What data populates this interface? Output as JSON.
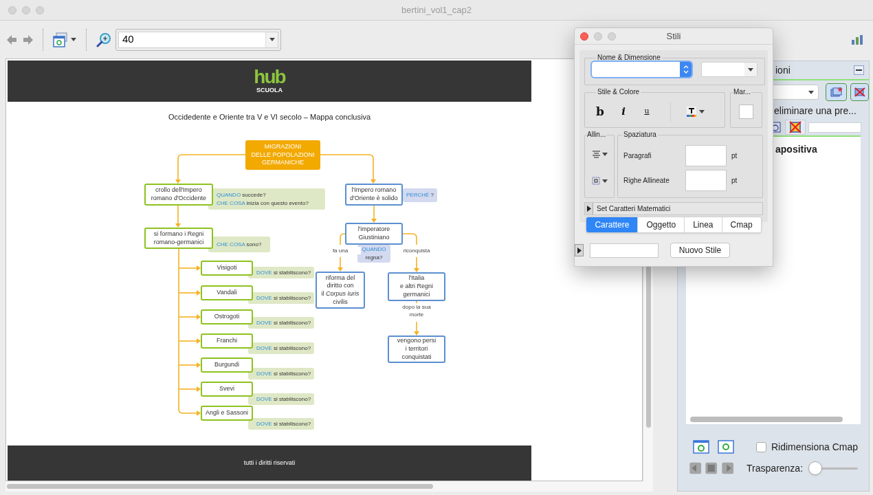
{
  "window": {
    "title": "bertini_vol1_cap2"
  },
  "toolbar": {
    "zoom_value": "40"
  },
  "document": {
    "logo": {
      "word": "hub",
      "tagline": "SCUOLA"
    },
    "map_title": "Occidedente e Oriente tra V e VI secolo – Mappa conclusiva",
    "nodes": [
      {
        "kind": "root",
        "text": "MIGRAZIONI\nDELLE POPOLAZIONI\nGERMANICHE"
      },
      {
        "kind": "west",
        "text": "crollo dell'Impero\nromano d'Occidente",
        "note": [
          {
            "text": "QUANDO",
            "keyword": true
          },
          {
            "text": " succede?\n",
            "keyword": false
          },
          {
            "text": "CHE COSA",
            "keyword": true
          },
          {
            "text": " inizia con questo evento?",
            "keyword": false
          }
        ]
      },
      {
        "kind": "west",
        "text": "si formano i Regni\nromano-germanici",
        "note": [
          {
            "text": "CHE COSA",
            "keyword": true
          },
          {
            "text": " sono?",
            "keyword": false
          }
        ]
      },
      {
        "kind": "west",
        "text": "Visigoti",
        "note": [
          {
            "text": "DOVE",
            "keyword": true
          },
          {
            "text": " si stabiliscono?",
            "keyword": false
          }
        ]
      },
      {
        "kind": "west",
        "text": "Vandali",
        "note": [
          {
            "text": "DOVE",
            "keyword": true
          },
          {
            "text": " si stabiliscono?",
            "keyword": false
          }
        ]
      },
      {
        "kind": "west",
        "text": "Ostrogoti",
        "note": [
          {
            "text": "DOVE",
            "keyword": true
          },
          {
            "text": " si stabiliscono?",
            "keyword": false
          }
        ]
      },
      {
        "kind": "west",
        "text": "Franchi",
        "note": [
          {
            "text": "DOVE",
            "keyword": true
          },
          {
            "text": " si stabiliscono?",
            "keyword": false
          }
        ]
      },
      {
        "kind": "west",
        "text": "Burgundi",
        "note": [
          {
            "text": "DOVE",
            "keyword": true
          },
          {
            "text": " si stabiliscono?",
            "keyword": false
          }
        ]
      },
      {
        "kind": "west",
        "text": "Svevi",
        "note": [
          {
            "text": "DOVE",
            "keyword": true
          },
          {
            "text": " si stabiliscono?",
            "keyword": false
          }
        ]
      },
      {
        "kind": "west",
        "text": "Angli e Sassoni",
        "note": [
          {
            "text": "DOVE",
            "keyword": true
          },
          {
            "text": " si stabiliscono?",
            "keyword": false
          }
        ]
      },
      {
        "kind": "east",
        "text": "l'Impero romano\nd'Oriente è solido",
        "note": [
          {
            "text": "PERCHÉ",
            "keyword": true
          },
          {
            "text": " ?",
            "keyword": false
          }
        ]
      },
      {
        "kind": "east",
        "text": "l'imperatore\nGiustiniano",
        "note": [
          {
            "text": "QUANDO",
            "keyword": true
          },
          {
            "text": "\nregna?",
            "keyword": false
          }
        ]
      },
      {
        "kind": "east",
        "text": "riforma del\ndiritto con\nil *Corpus Iuris*\ncivilis"
      },
      {
        "kind": "east",
        "text": "l'Italia\ne altri Regni\ngermanici"
      },
      {
        "kind": "east",
        "text": "vengono persi\ni territori\nconquistati"
      }
    ],
    "link_labels": [
      "fa una",
      "riconquista",
      "dopo la sua\nmorte"
    ],
    "footer": "tutti i diritti riservati"
  },
  "styles_dialog": {
    "title": "Stili",
    "name_size_label": "Nome & Dimensione",
    "style_color_label": "Stile & Colore",
    "style_buttons": [
      {
        "kind": "bold",
        "label": "b"
      },
      {
        "kind": "italic",
        "label": "i"
      },
      {
        "kind": "underline",
        "label": "u"
      }
    ],
    "margin_label": "Mar...",
    "align_label": "Allin...",
    "spacing_label": "Spaziatura",
    "spacing_rows": [
      {
        "label": "Paragrafi",
        "unit": "pt"
      },
      {
        "label": "Righe Allineate",
        "unit": "pt"
      }
    ],
    "math_set": "Set Caratteri Matematici",
    "tabs": [
      {
        "label": "Carattere",
        "selected": true
      },
      {
        "label": "Oggetto",
        "selected": false
      },
      {
        "label": "Linea",
        "selected": false
      },
      {
        "label": "Cmap",
        "selected": false
      }
    ],
    "new_style_button": "Nuovo Stile"
  },
  "side_panel": {
    "header": "ioni",
    "hint": "eliminare una pre...",
    "list_item": "apositiva",
    "resize_cmap": {
      "label": "Ridimensiona Cmap",
      "checked": false
    },
    "transparency": {
      "label": "Trasparenza:",
      "level": 0
    }
  }
}
